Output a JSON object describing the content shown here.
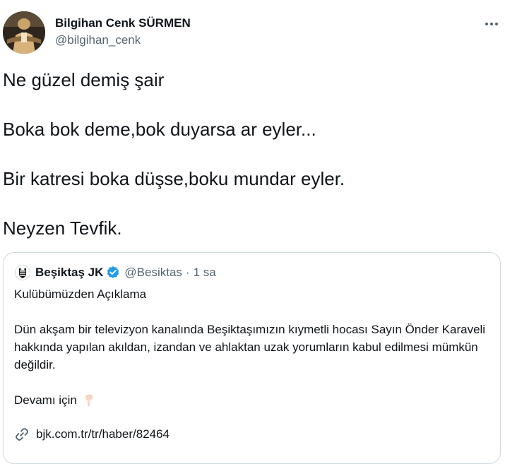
{
  "author": {
    "name": "Bilgihan Cenk SÜRMEN",
    "handle": "@bilgihan_cenk"
  },
  "tweet": {
    "lines": [
      "Ne güzel demiş şair",
      "Boka bok deme,bok duyarsa ar eyler...",
      "Bir katresi boka düşse,boku mundar eyler.",
      "Neyzen Tevfik."
    ]
  },
  "quoted": {
    "name": "Beşiktaş JK",
    "handle": "@Besiktas",
    "separator": "·",
    "time": "1 sa",
    "title": "Kulübümüzden Açıklama",
    "paragraph": "Dün akşam bir televizyon kanalında Beşiktaşımızın kıymetli hocası Sayın Önder Karaveli hakkında yapılan akıldan, izandan ve ahlaktan uzak yorumların kabul edilmesi mümkün değildir.",
    "more_label": "Devamı için",
    "link_text": "bjk.com.tr/tr/haber/82464"
  },
  "icons": {
    "more": "more-horizontal-icon",
    "verified": "verified-badge-icon",
    "pointing": "pointing-down-icon",
    "link": "link-icon",
    "club_logo": "besiktas-logo"
  },
  "colors": {
    "text": "#0f1419",
    "secondary": "#536471",
    "border": "#cfd9de",
    "verified": "#1d9bf0"
  }
}
